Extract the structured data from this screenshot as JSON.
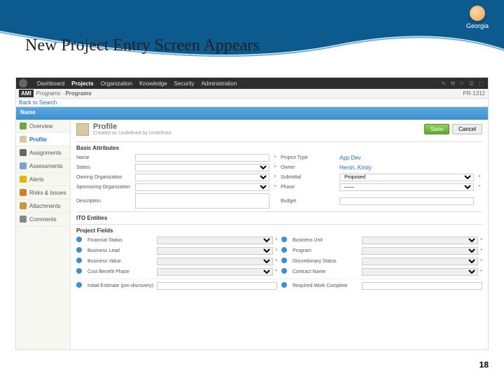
{
  "slide": {
    "title": "New Project Entry Screen Appears",
    "page": "18",
    "logo_text": "Georgia"
  },
  "topnav": {
    "items": [
      "Dashboard",
      "Projects",
      "Organization",
      "Knowledge",
      "Security",
      "Administration"
    ],
    "active_index": 1,
    "util": "✎ ⚒ ⚐ ☰ ⬚"
  },
  "crumb": {
    "ami": "AMI",
    "path1": "Programs ·",
    "path2": "Programs",
    "pid": "PR-1312"
  },
  "back": "Back to Search",
  "namebar": "Name",
  "sidebar": {
    "items": [
      {
        "label": "Overview",
        "color": "#6aa84f"
      },
      {
        "label": "Profile",
        "color": "#d9c9a3"
      },
      {
        "label": "Assignments",
        "color": "#666"
      },
      {
        "label": "Assessments",
        "color": "#7aa3c9"
      },
      {
        "label": "Alerts",
        "color": "#e6b800"
      },
      {
        "label": "Risks & Issues",
        "color": "#d97b2e"
      },
      {
        "label": "Attachments",
        "color": "#c49a3a"
      },
      {
        "label": "Comments",
        "color": "#888"
      }
    ],
    "active_index": 1
  },
  "profile": {
    "heading": "Profile",
    "sub": "Created on Undefined by Undefined",
    "save": "Save",
    "cancel": "Cancel"
  },
  "attrs": {
    "title": "Basic Attributes",
    "rows": [
      {
        "l": "Name",
        "ltype": "text",
        "lreq": true,
        "r": "Project Type",
        "rtype": "static",
        "rval": "App Dev"
      },
      {
        "l": "Status",
        "ltype": "select",
        "lreq": true,
        "r": "Owner",
        "rtype": "static",
        "rval": "Hersh, Kristy"
      },
      {
        "l": "Owning Organization",
        "ltype": "lookup",
        "lreq": true,
        "r": "Submittal",
        "rtype": "select",
        "rval": "Proposed",
        "rreq": true
      },
      {
        "l": "Sponsoring Organization",
        "ltype": "lookup",
        "lreq": true,
        "r": "Phase",
        "rtype": "select",
        "rval": "——",
        "rreq": true
      },
      {
        "l": "Description",
        "ltype": "textarea",
        "r": "Budget",
        "rtype": "text"
      }
    ]
  },
  "ito": {
    "title": "ITO Entities"
  },
  "pf": {
    "title": "Project Fields",
    "rows": [
      [
        "Financial Status",
        "Business Unit"
      ],
      [
        "Business Lead",
        "Program"
      ],
      [
        "Business Value",
        "Discretionary Status"
      ],
      [
        "Cost Benefit Phase",
        "Contract Name"
      ]
    ],
    "last": [
      "Initial Estimate (pre-discovery)",
      "Required Work Complete"
    ]
  }
}
